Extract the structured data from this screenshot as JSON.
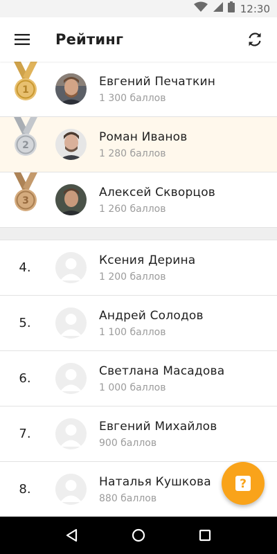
{
  "status_bar": {
    "time": "12:30",
    "icons": [
      "wifi-icon",
      "signal-icon",
      "battery-icon"
    ]
  },
  "app_bar": {
    "title": "Рейтинг",
    "menu_icon": "hamburger-menu-icon",
    "refresh_icon": "refresh-icon"
  },
  "leaderboard": {
    "top": [
      {
        "rank": "1",
        "medal": "gold",
        "name": "Евгений Печаткин",
        "score": "1 300 баллов",
        "highlighted": false
      },
      {
        "rank": "2",
        "medal": "silver",
        "name": "Роман Иванов",
        "score": "1 280 баллов",
        "highlighted": true
      },
      {
        "rank": "3",
        "medal": "bronze",
        "name": "Алексей Скворцов",
        "score": "1 260 баллов",
        "highlighted": false
      }
    ],
    "rest": [
      {
        "rank": "4.",
        "name": "Ксения Дерина",
        "score": "1 200 баллов"
      },
      {
        "rank": "5.",
        "name": "Андрей Солодов",
        "score": "1 100 баллов"
      },
      {
        "rank": "6.",
        "name": "Светлана Масадова",
        "score": "1 000 баллов"
      },
      {
        "rank": "7.",
        "name": "Евгений Михайлов",
        "score": "900 баллов"
      },
      {
        "rank": "8.",
        "name": "Наталья Кушкова",
        "score": "880 баллов"
      }
    ]
  },
  "fab": {
    "icon": "help-question-icon",
    "glyph": "?"
  },
  "colors": {
    "accent": "#f9a31a",
    "highlight_row": "#fff8ec",
    "gold": "#e0b35a",
    "silver": "#c3c7cc",
    "bronze": "#c49a6c"
  },
  "nav_bar": {
    "icons": [
      "back-icon",
      "home-icon",
      "recents-icon"
    ]
  }
}
